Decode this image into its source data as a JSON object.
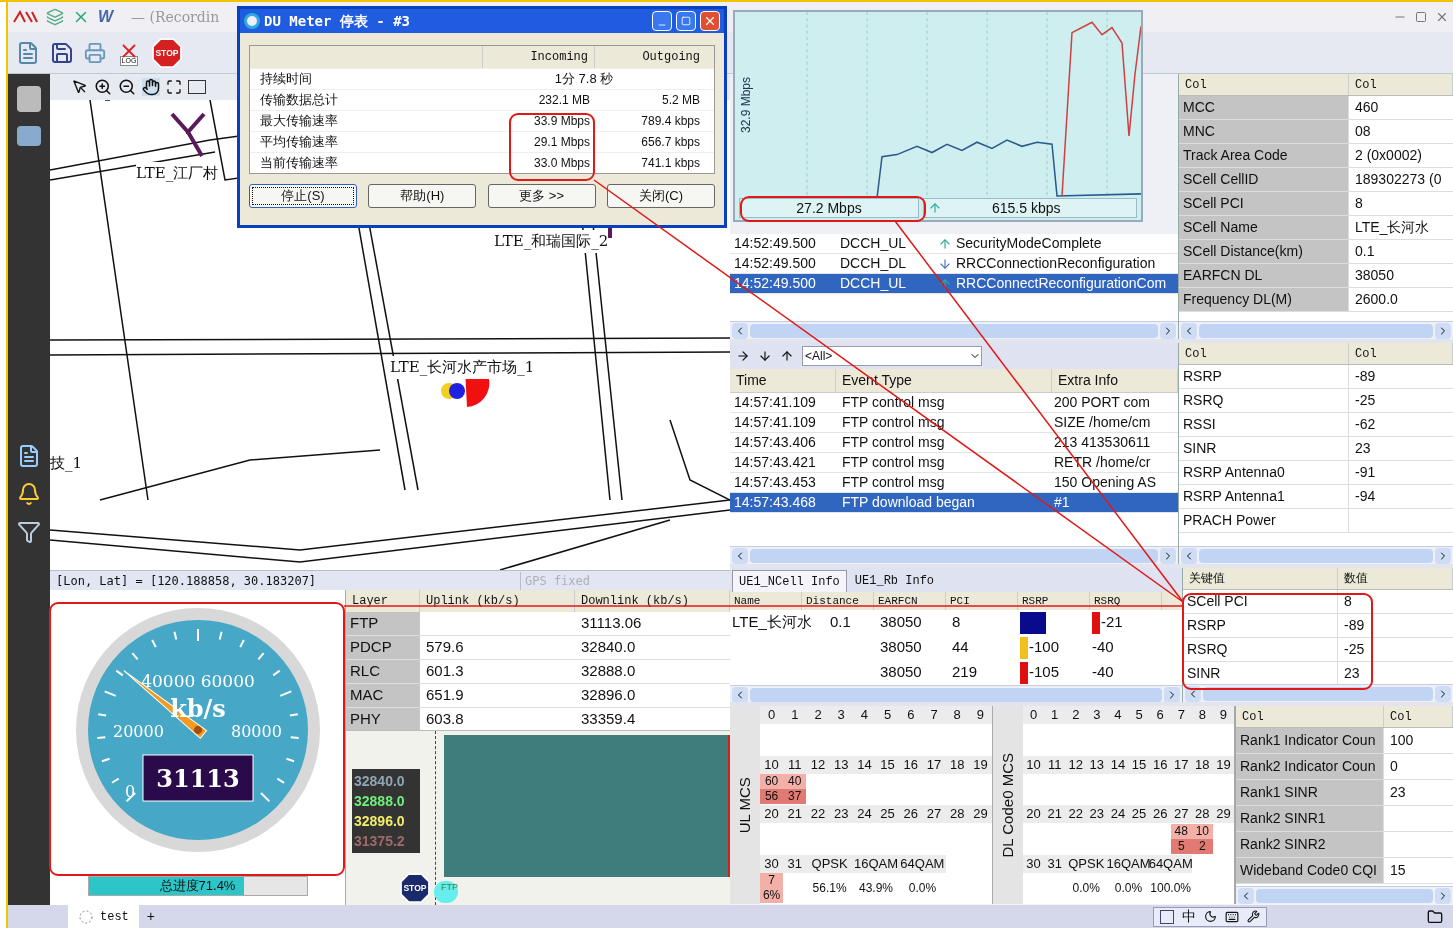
{
  "app": {
    "title": "— (Recordin",
    "word_icon": "W",
    "toolbar_labels": {
      "log": "LOG",
      "stop": "STOP"
    }
  },
  "du_meter": {
    "title": "DU Meter 停表 - #3",
    "columns": [
      "Incoming",
      "Outgoing"
    ],
    "rows": [
      {
        "kind": "merged",
        "label": "持续时间",
        "value": "1分 7.8 秒"
      },
      {
        "kind": "split",
        "label": "传输数据总计",
        "incoming": "232.1 MB",
        "outgoing": "5.2 MB"
      },
      {
        "kind": "split",
        "label": "最大传输速率",
        "incoming": "33.9 Mbps",
        "outgoing": "789.4 kbps"
      },
      {
        "kind": "split",
        "label": "平均传输速率",
        "incoming": "29.1 Mbps",
        "outgoing": "656.7 kbps"
      },
      {
        "kind": "split",
        "label": "当前传输速率",
        "incoming": "33.0 Mbps",
        "outgoing": "741.1 kbps"
      }
    ],
    "buttons": [
      {
        "label": "停止(S)",
        "selected": true
      },
      {
        "label": "帮助(H)",
        "selected": false
      },
      {
        "label": "更多 >>",
        "selected": false
      },
      {
        "label": "关闭(C)",
        "selected": false
      }
    ]
  },
  "graph": {
    "axis_label": "32.9 Mbps",
    "incoming": "27.2 Mbps",
    "outgoing": "615.5 kbps"
  },
  "map": {
    "labels": [
      "LTE_江厂村",
      "LTE_和瑞国际_2",
      "LTE_长河水产市场_1",
      "技_1"
    ],
    "coords": "[Lon, Lat] = [120.188858, 30.183207]",
    "gps": {
      "label": "GPS fixed",
      "disabled": true
    }
  },
  "messages": {
    "rows": [
      {
        "time": "14:52:49.500",
        "type": "DCCH_UL",
        "uplink": true,
        "title": "SecurityModeComplete",
        "selected": false
      },
      {
        "time": "14:52:49.500",
        "type": "DCCH_DL",
        "uplink": false,
        "title": "RRCConnectionReconfiguration",
        "selected": false
      },
      {
        "time": "14:52:49.500",
        "type": "DCCH_UL",
        "uplink": true,
        "title": "RRCConnectReconfigurationCom",
        "selected": true
      }
    ]
  },
  "cell_info": {
    "columns": [
      "Col",
      "Col"
    ],
    "rows": [
      {
        "label": "MCC",
        "value": "460"
      },
      {
        "label": "MNC",
        "value": "08"
      },
      {
        "label": "Track Area Code",
        "value": "2 (0x0002)"
      },
      {
        "label": "SCell CellID",
        "value": "189302273 (0"
      },
      {
        "label": "SCell PCI",
        "value": "8"
      },
      {
        "label": "SCell Name",
        "value": "LTE_长河水"
      },
      {
        "label": "SCell Distance(km)",
        "value": "0.1"
      },
      {
        "label": "EARFCN DL",
        "value": "38050"
      },
      {
        "label": "Frequency DL(M)",
        "value": "2600.0"
      }
    ]
  },
  "events": {
    "filter": "<All>",
    "columns": [
      "Time",
      "Event Type",
      "Extra Info"
    ],
    "rows": [
      {
        "time": "14:57:41.109",
        "type": "FTP control msg",
        "extra": "200 PORT com",
        "selected": false
      },
      {
        "time": "14:57:41.109",
        "type": "FTP control msg",
        "extra": "SIZE /home/cm",
        "selected": false
      },
      {
        "time": "14:57:43.406",
        "type": "FTP control msg",
        "extra": "213 413530611",
        "selected": false
      },
      {
        "time": "14:57:43.421",
        "type": "FTP control msg",
        "extra": "RETR /home/cr",
        "selected": false
      },
      {
        "time": "14:57:43.453",
        "type": "FTP control msg",
        "extra": "150 Opening AS",
        "selected": false
      },
      {
        "time": "14:57:43.468",
        "type": "FTP download began",
        "extra": "#1",
        "selected": true
      }
    ]
  },
  "radio": {
    "columns": [
      "Col",
      "Col"
    ],
    "rows": [
      {
        "label": "RSRP",
        "value": "-89"
      },
      {
        "label": "RSRQ",
        "value": "-25"
      },
      {
        "label": "RSSI",
        "value": "-62"
      },
      {
        "label": "SINR",
        "value": "23"
      },
      {
        "label": "RSRP Antenna0",
        "value": "-91"
      },
      {
        "label": "RSRP Antenna1",
        "value": "-94"
      },
      {
        "label": "PRACH Power"
      }
    ]
  },
  "ncell": {
    "tabs": [
      {
        "label": "UE1_NCell Info",
        "selected": true
      },
      {
        "label": "UE1_Rb Info",
        "selected": false
      }
    ],
    "columns": [
      "Name",
      "Distance",
      "EARFCN",
      "PCI",
      "RSRP",
      "RSRQ"
    ],
    "rows": [
      {
        "name": "LTE_长河水",
        "distance": "0.1",
        "earfcn": "38050",
        "pci": "8",
        "rsrp": {
          "color": "#0a0a8c"
        },
        "rsrq": {
          "text": "-21",
          "color": "#e01010"
        }
      },
      {
        "earfcn": "38050",
        "pci": "44",
        "rsrp": {
          "text": "-100",
          "color": "#f0c020"
        },
        "rsrq": {
          "text": "-40"
        }
      },
      {
        "earfcn": "38050",
        "pci": "219",
        "rsrp": {
          "text": "-105",
          "color": "#e01010"
        },
        "rsrq": {
          "text": "-40"
        }
      }
    ]
  },
  "key_values": {
    "columns": [
      "关键值",
      "数值"
    ],
    "rows": [
      {
        "label": "SCell PCI",
        "value": "8"
      },
      {
        "label": "RSRP",
        "value": "-89"
      },
      {
        "label": "RSRQ",
        "value": "-25"
      },
      {
        "label": "SINR",
        "value": "23"
      }
    ]
  },
  "ul_mcs": {
    "label": "UL MCS",
    "blocks": [
      [
        {
          "header": "0"
        },
        {
          "header": "1"
        },
        {
          "header": "2"
        },
        {
          "header": "3"
        },
        {
          "header": "4"
        },
        {
          "header": "5"
        },
        {
          "header": "6"
        },
        {
          "header": "7"
        },
        {
          "header": "8"
        },
        {
          "header": "9"
        }
      ],
      [
        {
          "header": "10",
          "values": [
            "60",
            "56"
          ],
          "heat": true
        },
        {
          "header": "11",
          "values": [
            "40",
            "37"
          ],
          "heat": true
        },
        {
          "header": "12"
        },
        {
          "header": "13"
        },
        {
          "header": "14"
        },
        {
          "header": "15"
        },
        {
          "header": "16"
        },
        {
          "header": "17"
        },
        {
          "header": "18"
        },
        {
          "header": "19"
        }
      ],
      [
        {
          "header": "20"
        },
        {
          "header": "21"
        },
        {
          "header": "22"
        },
        {
          "header": "23"
        },
        {
          "header": "24"
        },
        {
          "header": "25"
        },
        {
          "header": "26"
        },
        {
          "header": "27"
        },
        {
          "header": "28"
        },
        {
          "header": "29"
        }
      ],
      [
        {
          "header": "30",
          "values": [
            "76%"
          ],
          "heat": true
        },
        {
          "header": "31"
        },
        {
          "header": "QPSK",
          "kind": "summary",
          "values": [
            "56.1%"
          ]
        },
        {
          "header": "16QAM",
          "kind": "summary",
          "values": [
            "43.9%"
          ]
        },
        {
          "header": "64QAM",
          "kind": "summary",
          "values": [
            "0.0%"
          ]
        }
      ]
    ]
  },
  "dl_mcs": {
    "label": "DL Code0 MCS",
    "blocks": [
      [
        {
          "header": "0"
        },
        {
          "header": "1"
        },
        {
          "header": "2"
        },
        {
          "header": "3"
        },
        {
          "header": "4"
        },
        {
          "header": "5"
        },
        {
          "header": "6"
        },
        {
          "header": "7"
        },
        {
          "header": "8"
        },
        {
          "header": "9"
        }
      ],
      [
        {
          "header": "10"
        },
        {
          "header": "11"
        },
        {
          "header": "12"
        },
        {
          "header": "13"
        },
        {
          "header": "14"
        },
        {
          "header": "15"
        },
        {
          "header": "16"
        },
        {
          "header": "17"
        },
        {
          "header": "18"
        },
        {
          "header": "19"
        }
      ],
      [
        {
          "header": "20"
        },
        {
          "header": "21"
        },
        {
          "header": "22"
        },
        {
          "header": "23"
        },
        {
          "header": "24"
        },
        {
          "header": "25"
        },
        {
          "header": "26"
        },
        {
          "header": "27",
          "values": [
            "48",
            "5"
          ],
          "heat": true
        },
        {
          "header": "28",
          "values": [
            "10",
            "2"
          ],
          "heat": true
        },
        {
          "header": "29"
        }
      ],
      [
        {
          "header": "30"
        },
        {
          "header": "31"
        },
        {
          "header": "QPSK",
          "kind": "summary",
          "values": [
            "0.0%"
          ]
        },
        {
          "header": "16QAM",
          "kind": "summary",
          "values": [
            "0.0%"
          ]
        },
        {
          "header": "64QAM",
          "kind": "summary",
          "values": [
            "100.0%"
          ]
        }
      ]
    ]
  },
  "rank": {
    "columns": [
      "Col",
      "Col"
    ],
    "rows": [
      {
        "label": "Rank1 Indicator Coun",
        "value": "100"
      },
      {
        "label": "Rank2 Indicator Coun",
        "value": "0"
      },
      {
        "label": "Rank1 SINR",
        "value": "23"
      },
      {
        "label": "Rank2 SINR1"
      },
      {
        "label": "Rank2 SINR2"
      },
      {
        "label": "Wideband Code0 CQI",
        "value": "15"
      }
    ]
  },
  "gauge": {
    "scale_labels": [
      "40000 60000",
      "20000",
      "80000",
      "0"
    ],
    "unit": "kb/s",
    "value": "31113",
    "level": 0.31
  },
  "progress": {
    "label": "总进度71.4%",
    "level": 0.714
  },
  "layers": {
    "columns": [
      "Layer",
      "Uplink (kb/s)",
      "Downlink (kb/s)"
    ],
    "rows": [
      {
        "layer": "FTP",
        "downlink": "31113.06"
      },
      {
        "layer": "PDCP",
        "uplink": "579.6",
        "downlink": "32840.0"
      },
      {
        "layer": "RLC",
        "uplink": "601.3",
        "downlink": "32888.0"
      },
      {
        "layer": "MAC",
        "uplink": "651.9",
        "downlink": "32896.0"
      },
      {
        "layer": "PHY",
        "uplink": "603.8",
        "downlink": "33359.4"
      }
    ]
  },
  "throughput_chart": {
    "labels": [
      {
        "text": "32840.0",
        "color": "#8fa6b4"
      },
      {
        "text": "32888.0",
        "color": "#6ef07a"
      },
      {
        "text": "32896.0",
        "color": "#f2ee6a"
      },
      {
        "text": "31375.2",
        "color": "#a06a6a"
      }
    ],
    "ftp_label": "FTP",
    "stop_label": "STOP"
  },
  "tabs": [
    {
      "label": "test",
      "selected": true
    }
  ],
  "add_tab": "+",
  "taskbar": {
    "ime": "中"
  }
}
